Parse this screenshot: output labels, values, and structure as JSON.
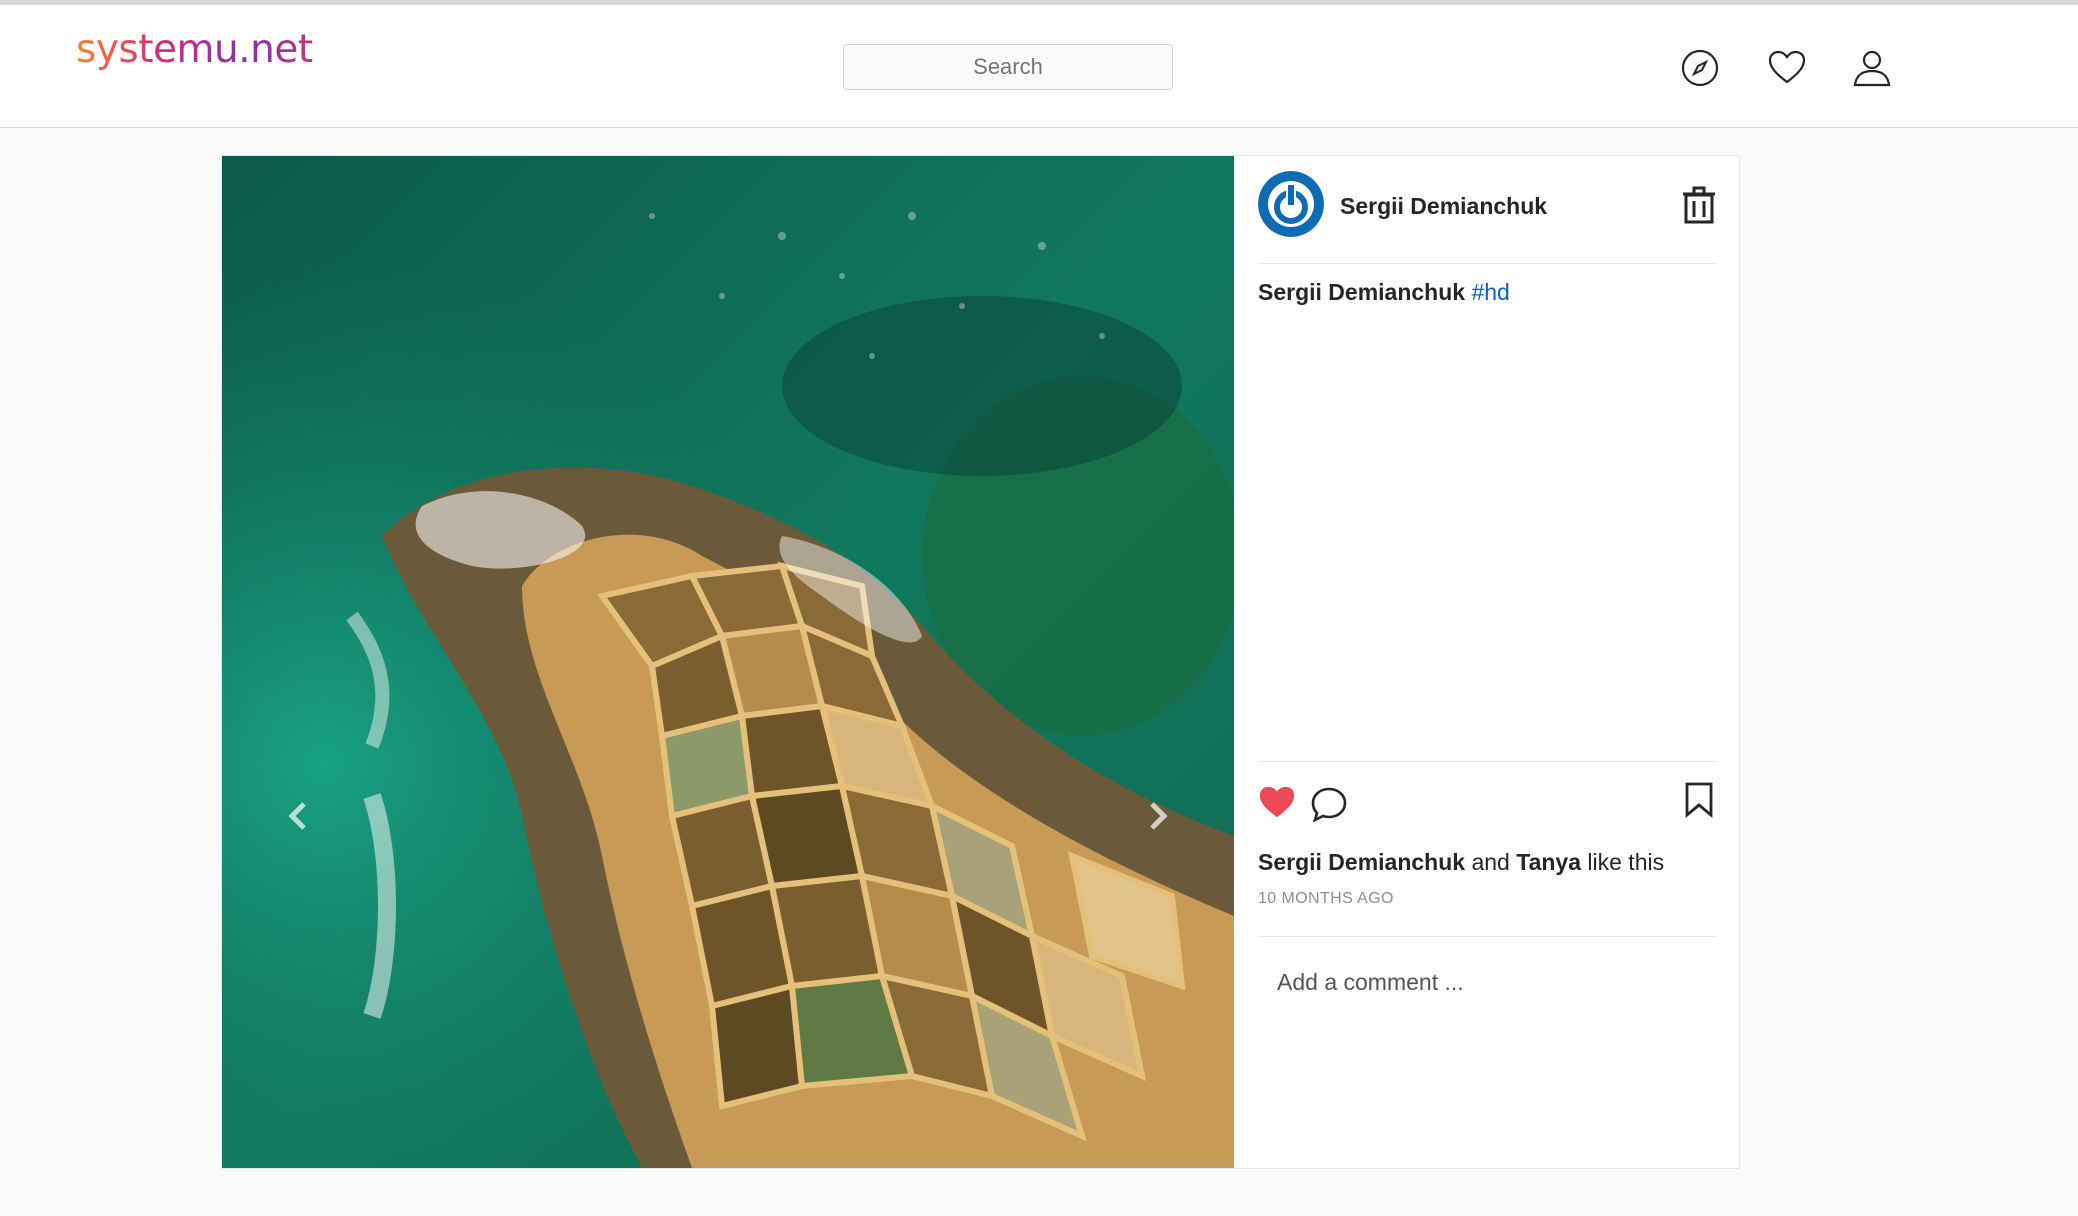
{
  "header": {
    "logo": "systemu.net",
    "search_placeholder": "Search",
    "icons": [
      "compass-icon",
      "heart-icon",
      "user-icon"
    ]
  },
  "post": {
    "author": "Sergii Demianchuk",
    "caption": {
      "author": "Sergii Demianchuk",
      "hashtag": "#hd"
    },
    "likes": {
      "user1": "Sergii Demianchuk",
      "connector": "and",
      "user2": "Tanya",
      "suffix": "like this"
    },
    "time": "10 MONTHS AGO",
    "comment_placeholder": "Add a comment ...",
    "liked": true,
    "colors": {
      "liked_heart": "#ed4956",
      "hashtag": "#0a5fcf",
      "avatar": "#0f6bb3"
    }
  }
}
